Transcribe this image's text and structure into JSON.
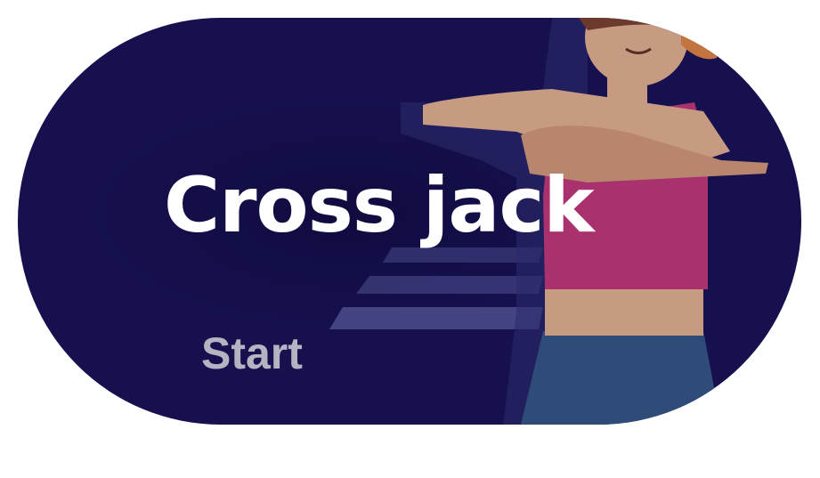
{
  "card": {
    "title": "Cross jack",
    "start_label": "Start"
  },
  "colors": {
    "card_background": "#16104f",
    "title_text": "#ffffff",
    "start_text": "#b3b3c2",
    "top": "#a8316e",
    "pants": "#2f4c78",
    "skin": "#c79a82",
    "hair": "#c4743f"
  },
  "illustration": {
    "name": "woman-exercising-illustration"
  }
}
